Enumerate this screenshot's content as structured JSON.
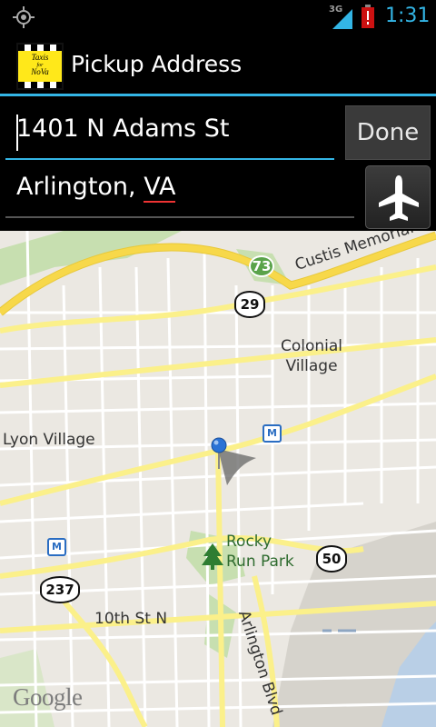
{
  "status_bar": {
    "network": "3G",
    "time": "1:31"
  },
  "action_bar": {
    "logo_lines": [
      "Taxis",
      "for",
      "NoVa"
    ],
    "title": "Pickup Address"
  },
  "form": {
    "street_value": "1401 N Adams St",
    "city_value_part1": "Arlington, ",
    "city_value_part2": "VA",
    "done_label": "Done",
    "airport_icon": "airplane-icon"
  },
  "map": {
    "labels": {
      "colonial_village": "Colonial\nVillage",
      "lyon_village": "Lyon Village",
      "rocky_run_park": "Rocky\nRun Park",
      "curtis_memorial": "Custis Memorial P",
      "tenth_st": "10th St N",
      "arlington_blvd": "Arlington Blvd"
    },
    "shields": {
      "route_73": "73",
      "route_29": "29",
      "route_50": "50",
      "route_237": "237"
    },
    "metro_label": "M",
    "attribution": "Google",
    "colors": {
      "land": "#ebe8e2",
      "highway": "#f7d84a",
      "major_road": "#fbf08a",
      "park": "#c7dfb0",
      "pin": "#2a72d5"
    }
  }
}
